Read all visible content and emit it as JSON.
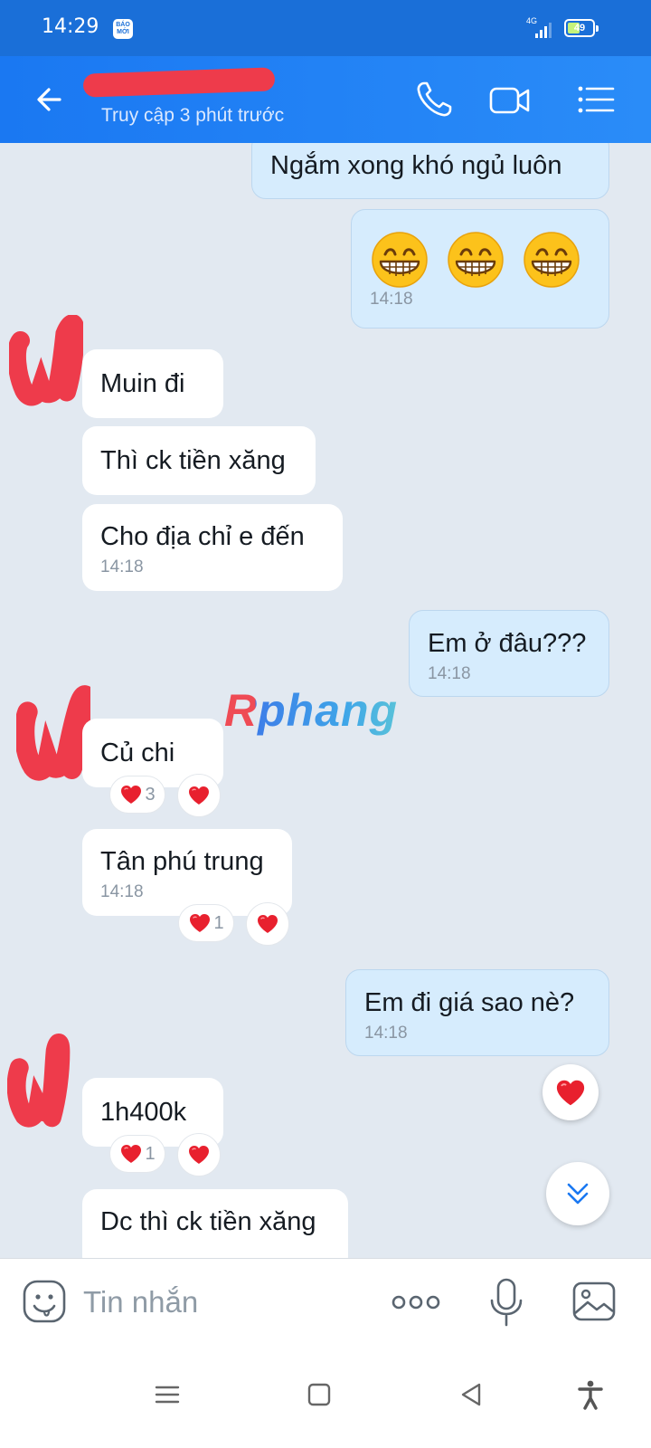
{
  "status_bar": {
    "time": "14:29",
    "notification_app": "BÁO MỚI",
    "network": "4G",
    "signal_level": 0.75,
    "battery": "49",
    "battery_level": 0.49
  },
  "header": {
    "last_seen": "Truy cập 3 phút trước",
    "icons": [
      "back-arrow",
      "phone",
      "video-camera",
      "menu-list"
    ]
  },
  "messages": [
    {
      "side": "out",
      "text": "Ngắm xong khó ngủ luôn",
      "time": ""
    },
    {
      "side": "out",
      "emoji": "😁😁😁",
      "time": "14:18"
    },
    {
      "side": "in",
      "text": "Muin đi",
      "time": ""
    },
    {
      "side": "in",
      "text": "Thì ck tiền xăng",
      "time": ""
    },
    {
      "side": "in",
      "text": "Cho địa chỉ e đến",
      "time": "14:18"
    },
    {
      "side": "out",
      "text": "Em ở đâu???",
      "time": "14:18"
    },
    {
      "side": "in",
      "text": "Củ chi",
      "time": "",
      "reaction_count": "3"
    },
    {
      "side": "in",
      "text": "Tân phú trung",
      "time": "14:18",
      "reaction_count": "1"
    },
    {
      "side": "out",
      "text": "Em đi giá sao nè?",
      "time": "14:18"
    },
    {
      "side": "in",
      "text": "1h400k",
      "time": "",
      "reaction_count": "1"
    },
    {
      "side": "in",
      "text": "Dc thì ck tiền xăng",
      "time": ""
    }
  ],
  "watermark": "Rphang",
  "composer": {
    "placeholder": "Tin nhắn"
  },
  "colors": {
    "header": "#1a78f2",
    "incoming_bubble": "#ffffff",
    "outgoing_bubble": "#d6ecfd",
    "chat_background": "#e2e9f1",
    "heart": "#e8202e"
  }
}
